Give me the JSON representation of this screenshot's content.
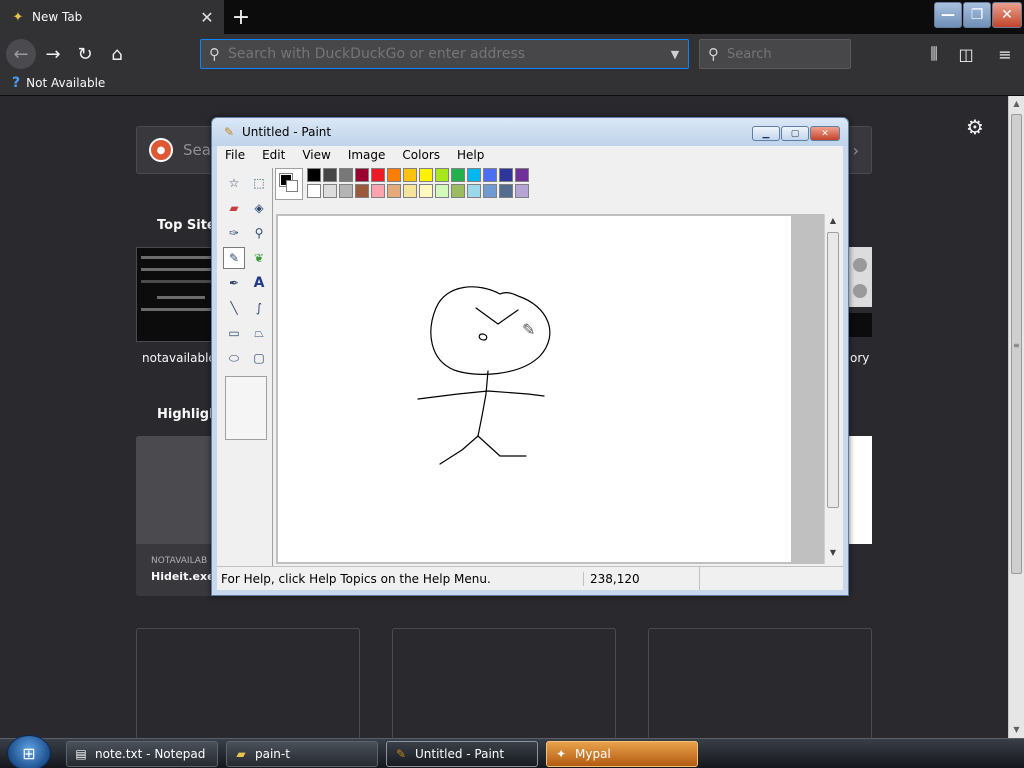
{
  "browser": {
    "tab": {
      "title": "New Tab",
      "close": "✕"
    },
    "new_tab": "+",
    "window_controls": {
      "minimize": "—",
      "maximize": "❐",
      "close": "✕"
    },
    "url": {
      "placeholder": "Search with DuckDuckGo or enter address"
    },
    "search": {
      "placeholder": "Search"
    },
    "bookmarks": [
      {
        "label": "Not Available"
      }
    ],
    "accent_color": "#0a84ff"
  },
  "newtab_page": {
    "search_placeholder": "Sear",
    "top_sites_heading": "Top Sites",
    "top_sites": [
      {
        "label": "notavailable."
      }
    ],
    "right_tile_label": "ory",
    "highlights_heading": "Highligh",
    "highlight": {
      "source": "NOTAVAILAB",
      "title": "Hideit.exe"
    }
  },
  "paint": {
    "title": "Untitled - Paint",
    "menu": [
      "File",
      "Edit",
      "View",
      "Image",
      "Colors",
      "Help"
    ],
    "tools": [
      "free-form-select-icon",
      "select-icon",
      "eraser-icon",
      "fill-icon",
      "pick-color-icon",
      "magnifier-icon",
      "pencil-icon",
      "brush-icon",
      "airbrush-icon",
      "text-icon",
      "line-icon",
      "curve-icon",
      "rectangle-icon",
      "polygon-icon",
      "ellipse-icon",
      "rounded-rectangle-icon"
    ],
    "selected_tool": "pencil-icon",
    "palette_top": [
      "#000000",
      "#464646",
      "#787878",
      "#990030",
      "#ed1c24",
      "#ff7e00",
      "#ffc20e",
      "#fff200",
      "#a8e61d",
      "#22b14c",
      "#00b7ef",
      "#4d6df3",
      "#2f3699",
      "#6f3198"
    ],
    "palette_bottom": [
      "#ffffff",
      "#dcdcdc",
      "#b4b4b4",
      "#9c5a3c",
      "#ffa3b1",
      "#e5aa7a",
      "#f5e49c",
      "#fff9bd",
      "#d3f9bc",
      "#9dbb61",
      "#99d9ea",
      "#709ad1",
      "#546d8e",
      "#b5a5d5"
    ],
    "foreground": "#000000",
    "background": "#ffffff",
    "status_help": "For Help, click Help Topics on the Help Menu.",
    "status_coords": "238,120"
  },
  "taskbar": {
    "items": [
      {
        "label": "note.txt - Notepad",
        "icon": "notepad-icon"
      },
      {
        "label": "pain-t",
        "icon": "folder-icon"
      },
      {
        "label": "Untitled - Paint",
        "icon": "paint-icon"
      },
      {
        "label": "Mypal",
        "icon": "mypal-icon"
      }
    ]
  }
}
